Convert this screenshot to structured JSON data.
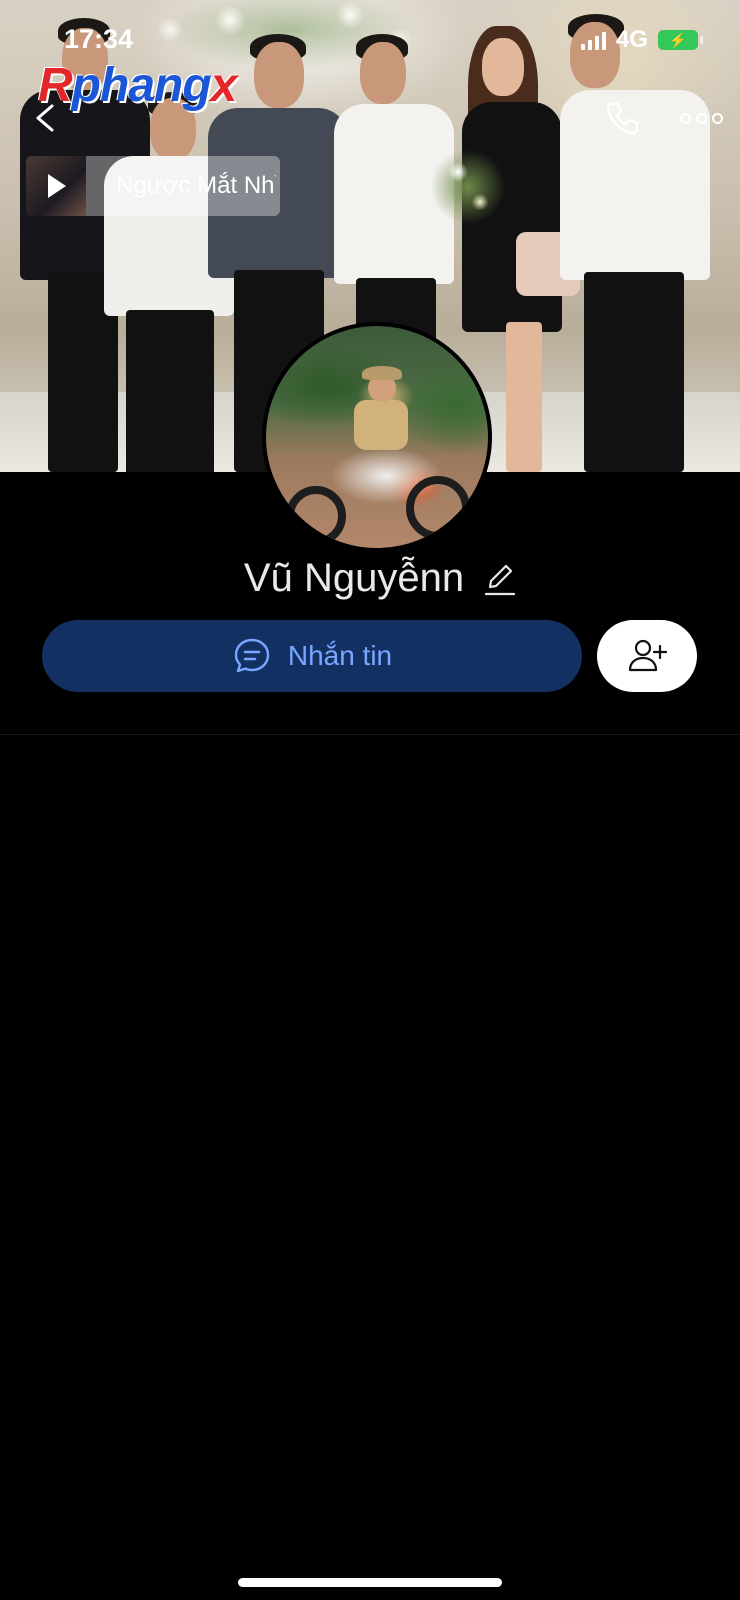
{
  "status_bar": {
    "time": "17:34",
    "network": "4G"
  },
  "watermark": {
    "first": "R",
    "middle": "phang",
    "last": "x"
  },
  "music": {
    "title": "Ngược Mắt Nhìn"
  },
  "profile": {
    "name": "Vũ Nguyễnn"
  },
  "actions": {
    "message_label": "Nhắn tin"
  },
  "colors": {
    "message_button_bg": "#133063",
    "message_button_text": "#79a6ff",
    "battery": "#35c759"
  },
  "icons": {
    "back": "chevron-left-icon",
    "call": "phone-icon",
    "more": "more-dots-icon",
    "play": "play-icon",
    "edit": "pencil-icon",
    "chat": "chat-bubble-icon",
    "add_friend": "add-user-icon"
  }
}
